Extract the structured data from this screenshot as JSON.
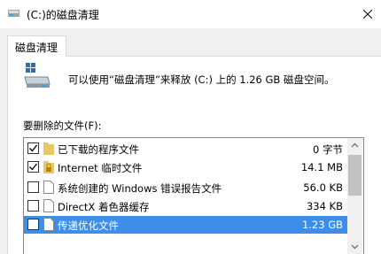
{
  "window": {
    "title": "(C:)的磁盘清理",
    "close_icon": "close-icon"
  },
  "tab": {
    "label": "磁盘清理"
  },
  "description": "可以使用“磁盘清理”来释放  (C:) 上的 1.26 GB 磁盘空间。",
  "files_label": "要删除的文件(F):",
  "files": [
    {
      "name": "已下载的程序文件",
      "size": "0 字节",
      "checked": true,
      "icon": "folder-icon"
    },
    {
      "name": "Internet 临时文件",
      "size": "14.1 MB",
      "checked": true,
      "icon": "lock-folder-icon"
    },
    {
      "name": "系统创建的 Windows 错误报告文件",
      "size": "56.0 KB",
      "checked": false,
      "icon": "file-icon"
    },
    {
      "name": "DirectX 着色器缓存",
      "size": "334 KB",
      "checked": false,
      "icon": "file-icon"
    },
    {
      "name": "传递优化文件",
      "size": "1.23 GB",
      "checked": false,
      "icon": "file-icon",
      "selected": true
    }
  ],
  "colors": {
    "selection": "#3d8ee8",
    "folder": "#e8c766",
    "accent": "#1e73c8"
  }
}
